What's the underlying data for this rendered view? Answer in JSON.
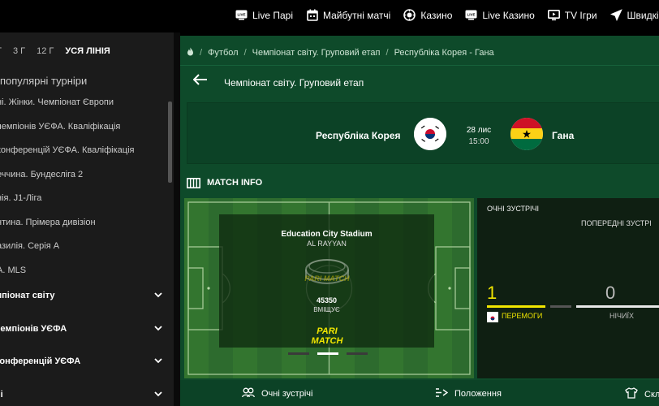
{
  "topnav": [
    {
      "label": "Live Парі",
      "icon": "live-icon"
    },
    {
      "label": "Майбутні матчі",
      "icon": "calendar-icon"
    },
    {
      "label": "Казино",
      "icon": "casino-chip-icon"
    },
    {
      "label": "Live Казино",
      "icon": "live-casino-icon"
    },
    {
      "label": "TV Ігри",
      "icon": "tv-icon"
    },
    {
      "label": "Швидкі Ігри",
      "icon": "plane-icon"
    }
  ],
  "sidebar": {
    "periods": [
      "Г",
      "3 Г",
      "12 Г",
      "УСЯ ЛІНІЯ"
    ],
    "heading": "популярні турніри",
    "tournaments": [
      "ні. Жінки. Чемпіонат Європи",
      "чемпіонів УЄФА. Кваліфікація",
      "конференцій УЄФА. Кваліфікація",
      "еччина. Бундесліга 2",
      "нія. J1-Ліга",
      "нтина. Прімера дивізіон",
      "азилія. Серія А",
      "А. MLS"
    ],
    "groups": [
      "мпіонат світу",
      "чемпіонів УЄФА",
      "конференцій УЄФА",
      "ні"
    ]
  },
  "breadcrumb": {
    "items": [
      "Футбол",
      "Чемпіонат світу. Груповий етап",
      "Республіка Корея - Гана"
    ]
  },
  "league_title": "Чемпіонат світу. Груповий етап",
  "match": {
    "home": "Республіка Корея",
    "away": "Гана",
    "date": "28 лис",
    "time": "15:00"
  },
  "match_info": {
    "title": "MATCH INFO",
    "stadium": "Education City Stadium",
    "city": "AL RAYYAN",
    "capacity": "45350",
    "capacity_label": "ВМІЩУЄ",
    "logo_text": "PARI MATCH"
  },
  "stats": {
    "h2h_title": "ОЧНІ ЗУСТРІЧІ",
    "previous_title": "ПОПЕРЕДНІ ЗУСТРІ",
    "wins_value": "1",
    "wins_label": "ПЕРЕМОГИ",
    "draws_value": "0",
    "draws_label": "НІЧИЇХ"
  },
  "tabs": [
    {
      "label": "Очні зустрічі",
      "icon": "h2h-icon"
    },
    {
      "label": "Положення",
      "icon": "standings-icon"
    },
    {
      "label": "Скл",
      "icon": "lineup-shirt-icon"
    }
  ],
  "colors": {
    "accent_yellow": "#f1e600",
    "main_green": "#0e4a2a",
    "pitch_green": "#2d6b2e"
  }
}
